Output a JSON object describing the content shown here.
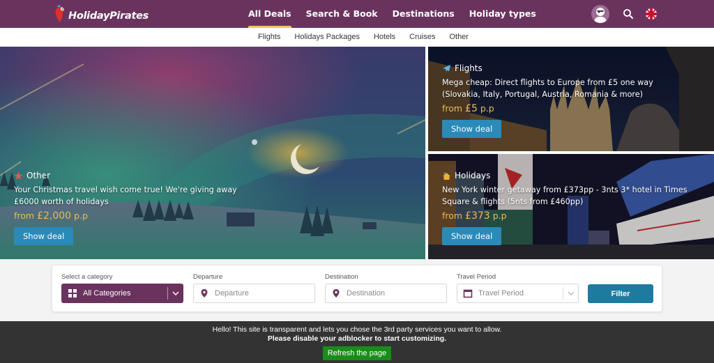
{
  "header": {
    "logo_text": "HolidayPirates",
    "nav": [
      {
        "label": "All Deals",
        "active": true
      },
      {
        "label": "Search & Book",
        "active": false
      },
      {
        "label": "Destinations",
        "active": false
      },
      {
        "label": "Holiday types",
        "active": false
      }
    ],
    "icons": [
      "user-avatar-icon",
      "search-icon",
      "uk-flag-icon"
    ]
  },
  "subnav": {
    "items": [
      {
        "label": "Flights"
      },
      {
        "label": "Holidays Packages"
      },
      {
        "label": "Hotels"
      },
      {
        "label": "Cruises"
      },
      {
        "label": "Other"
      }
    ]
  },
  "deals": [
    {
      "category": "Other",
      "category_icon": "star-icon",
      "title": "Your Christmas travel wish come true! We're giving away £6000 worth of holidays",
      "price_prefix": "from",
      "price": "£2,000",
      "price_suffix": "p.p",
      "button": "Show deal"
    },
    {
      "category": "Flights",
      "category_icon": "plane-icon",
      "title": "Mega cheap: Direct flights to Europe from £5 one way (Slovakia, Italy, Portugal, Austria, Romania & more)",
      "price_prefix": "from",
      "price": "£5",
      "price_suffix": "p.p",
      "button": "Show deal"
    },
    {
      "category": "Holidays",
      "category_icon": "holiday-home-icon",
      "title": "New York winter getaway from £373pp - 3nts 3* hotel in Times Square & flights (5nts from £460pp)",
      "price_prefix": "from",
      "price": "£373",
      "price_suffix": "p.p",
      "button": "Show deal"
    }
  ],
  "filter": {
    "category": {
      "label": "Select a category",
      "value": "All Categories"
    },
    "departure": {
      "label": "Departure",
      "placeholder": "Departure"
    },
    "destination": {
      "label": "Destination",
      "placeholder": "Destination"
    },
    "travel_period": {
      "label": "Travel Period",
      "placeholder": "Travel Period"
    },
    "button": "Filter"
  },
  "cookie_bar": {
    "line1": "Hello! This site is transparent and lets you chose the 3rd party services you want to allow.",
    "line2": "Please disable your adblocker to start customizing.",
    "button": "Refresh the page"
  },
  "colors": {
    "brand_purple": "#6a335e",
    "accent_yellow": "#f2c35f",
    "button_blue": "#2a8ab8",
    "filter_blue": "#1f7aa0",
    "price_gold": "#e8bd5a",
    "refresh_green": "#198c19"
  }
}
